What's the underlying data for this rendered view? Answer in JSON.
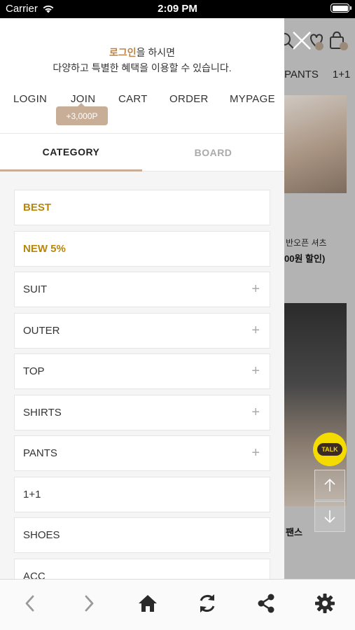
{
  "status_bar": {
    "carrier": "Carrier",
    "time": "2:09 PM"
  },
  "drawer": {
    "greeting": {
      "brand": "로그인",
      "line1_rest": "을 하시면",
      "line2": "다양하고 특별한 혜택을 이용할 수 있습니다."
    },
    "nav": [
      {
        "label": "LOGIN"
      },
      {
        "label": "JOIN"
      },
      {
        "label": "CART"
      },
      {
        "label": "ORDER"
      },
      {
        "label": "MYPAGE"
      }
    ],
    "join_badge": "+3,000P",
    "tabs": {
      "category": "CATEGORY",
      "board": "BOARD"
    },
    "categories": [
      {
        "label": "BEST",
        "expandable": false
      },
      {
        "label": "NEW 5%",
        "expandable": false
      },
      {
        "label": "SUIT",
        "expandable": true
      },
      {
        "label": "OUTER",
        "expandable": true
      },
      {
        "label": "TOP",
        "expandable": true
      },
      {
        "label": "SHIRTS",
        "expandable": true
      },
      {
        "label": "PANTS",
        "expandable": true
      },
      {
        "label": "1+1",
        "expandable": false
      },
      {
        "label": "SHOES",
        "expandable": false
      },
      {
        "label": "ACC",
        "expandable": false
      }
    ],
    "plus_symbol": "+",
    "accent_color": "#b8860b",
    "badge_color": "#c8ae96"
  },
  "background_page": {
    "tabs": [
      "PANTS",
      "1+1"
    ],
    "product1_name": "반오픈 셔츠",
    "product1_price": "00원 할인)",
    "product2_name": "팬스",
    "cart_count": "0",
    "wish_count": "0",
    "talk_label": "TALK"
  },
  "toolbar": {
    "icons": [
      "back-icon",
      "forward-icon",
      "home-icon",
      "refresh-icon",
      "share-icon",
      "settings-icon"
    ]
  }
}
